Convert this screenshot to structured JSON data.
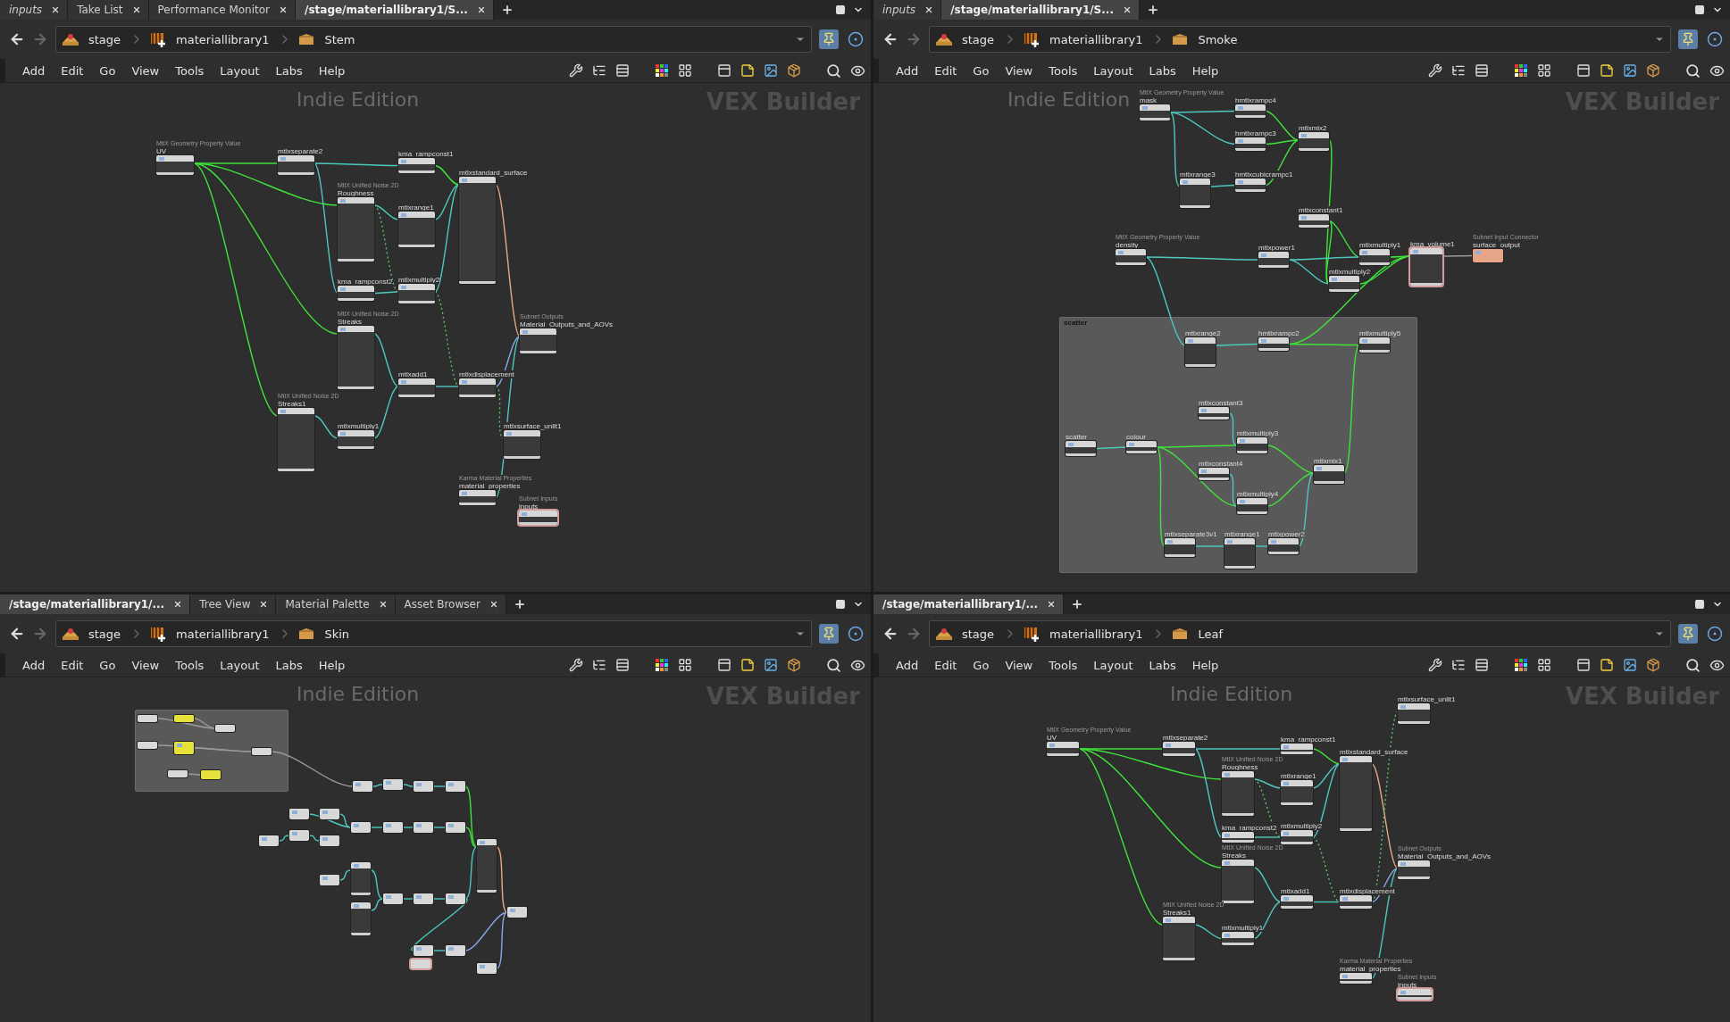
{
  "panes": [
    {
      "tabs": [
        {
          "label": "inputs",
          "selected": false,
          "italic": true
        },
        {
          "label": "Take List",
          "selected": false,
          "italic": false
        },
        {
          "label": "Performance Monitor",
          "selected": false,
          "italic": false
        },
        {
          "label": "/stage/materiallibrary1/S...",
          "selected": true,
          "italic": false
        }
      ],
      "path": [
        "stage",
        "materiallibrary1",
        "Stem"
      ],
      "menu": [
        "Add",
        "Edit",
        "Go",
        "View",
        "Tools",
        "Layout",
        "Labs",
        "Help"
      ],
      "watermarks": [
        "Indie Edition",
        "VEX Builder"
      ],
      "nodes": [
        {
          "subtitle": "MtlX Geometry Property Value",
          "name": "UV",
          "outlined": false
        },
        {
          "name": "mtlxseparate2",
          "outlined": false
        },
        {
          "name": "kma_rampconst1",
          "outlined": false
        },
        {
          "name": "mtlxstandard_surface",
          "outlined": false
        },
        {
          "subtitle": "MtlX Unified Noise 2D",
          "name": "Roughness",
          "outlined": false
        },
        {
          "name": "mtlxrange1",
          "outlined": false
        },
        {
          "name": "kma_rampconst2",
          "outlined": false
        },
        {
          "name": "mtlxmultiply2",
          "outlined": false
        },
        {
          "subtitle": "MtlX Unified Noise 2D",
          "name": "Streaks",
          "outlined": false
        },
        {
          "name": "mtlxadd1",
          "outlined": false
        },
        {
          "name": "mtlxdisplacement",
          "outlined": false
        },
        {
          "subtitle": "Subnet Outputs",
          "name": "Material_Outputs_and_AOVs",
          "outlined": false
        },
        {
          "subtitle": "MtlX Unified Noise 2D",
          "name": "Streaks1",
          "outlined": false
        },
        {
          "name": "mtlxmultiply1",
          "outlined": false
        },
        {
          "name": "mtlxsurface_unlit1",
          "outlined": false
        },
        {
          "subtitle": "Karma Material Properties",
          "name": "material_properties",
          "outlined": false
        },
        {
          "subtitle": "Subnet Inputs",
          "name": "inputs",
          "outlined": true
        }
      ]
    },
    {
      "tabs": [
        {
          "label": "inputs",
          "selected": false,
          "italic": true
        },
        {
          "label": "/stage/materiallibrary1/S...",
          "selected": true,
          "italic": false
        }
      ],
      "path": [
        "stage",
        "materiallibrary1",
        "Smoke"
      ],
      "menu": [
        "Add",
        "Edit",
        "Go",
        "View",
        "Tools",
        "Layout",
        "Labs",
        "Help"
      ],
      "watermarks": [
        "Indie Edition",
        "VEX Builder"
      ],
      "nodes": [
        {
          "subtitle": "MtlX Geometry Property Value",
          "name": "mask",
          "outlined": false
        },
        {
          "name": "hmtlxrampc4",
          "outlined": false
        },
        {
          "name": "hmtlxrampc3",
          "outlined": false
        },
        {
          "name": "mtlxmix2",
          "outlined": false
        },
        {
          "name": "mtlxrange3",
          "outlined": false
        },
        {
          "name": "hmtlxcubicrampc1",
          "outlined": false
        },
        {
          "name": "mtlxconstant1",
          "outlined": false
        },
        {
          "subtitle": "MtlX Geometry Property Value",
          "name": "density",
          "outlined": false
        },
        {
          "name": "mtlxpower1",
          "outlined": false
        },
        {
          "name": "mtlxmultiply1",
          "outlined": false
        },
        {
          "name": "mtlxmultiply2",
          "outlined": false
        },
        {
          "name": "kma_volume1",
          "outlined": true
        },
        {
          "subtitle": "Subnet Input Connector",
          "name": "surface_output",
          "outlined": false,
          "color": "#e8a688"
        }
      ],
      "network_box": {
        "title": "scatter",
        "nodes": [
          {
            "name": "mtlxrange2",
            "outlined": false
          },
          {
            "name": "hmtlxrampc2",
            "outlined": false
          },
          {
            "name": "mtlxmultiply5",
            "outlined": false
          },
          {
            "name": "mtlxconstant3",
            "outlined": false
          },
          {
            "name": "scatter",
            "outlined": false
          },
          {
            "name": "colour",
            "outlined": false
          },
          {
            "name": "mtlxmultiply3",
            "outlined": false
          },
          {
            "name": "mtlxconstant4",
            "outlined": false
          },
          {
            "name": "mtlxmix1",
            "outlined": false
          },
          {
            "name": "mtlxmultiply4",
            "outlined": false
          },
          {
            "name": "mtlxseparate3v1",
            "outlined": false
          },
          {
            "name": "mtlxrange1",
            "outlined": false
          },
          {
            "name": "mtlxpower2",
            "outlined": false
          }
        ]
      }
    },
    {
      "tabs": [
        {
          "label": "/stage/materiallibrary1/...",
          "selected": true,
          "italic": false
        },
        {
          "label": "Tree View",
          "selected": false,
          "italic": false
        },
        {
          "label": "Material Palette",
          "selected": false,
          "italic": false
        },
        {
          "label": "Asset Browser",
          "selected": false,
          "italic": false
        }
      ],
      "path": [
        "stage",
        "materiallibrary1",
        "Skin"
      ],
      "menu": [
        "Add",
        "Edit",
        "Go",
        "View",
        "Tools",
        "Layout",
        "Labs",
        "Help"
      ],
      "watermarks": [
        "Indie Edition",
        "VEX Builder"
      ],
      "nodes": [
        {
          "outlined": false,
          "color": "#d8d8d8"
        },
        {
          "outlined": false,
          "color": "#e6e23a"
        },
        {
          "outlined": false,
          "color": "#d8d8d8"
        },
        {
          "outlined": false,
          "color": "#d8d8d8"
        },
        {
          "outlined": false,
          "color": "#e6e23a"
        },
        {
          "outlined": false,
          "color": "#d8d8d8"
        },
        {
          "outlined": false,
          "color": "#d8d8d8"
        },
        {
          "outlined": false,
          "color": "#e6e23a"
        },
        {
          "outlined": false,
          "color": "#d8d8d8"
        },
        {
          "outlined": false,
          "color": "#d8d8d8"
        },
        {
          "outlined": false,
          "color": "#d8d8d8"
        },
        {
          "outlined": false,
          "color": "#d8d8d8"
        },
        {
          "outlined": false,
          "color": "#d8d8d8"
        },
        {
          "outlined": false,
          "color": "#d8d8d8"
        },
        {
          "outlined": false,
          "color": "#d8d8d8"
        },
        {
          "outlined": false,
          "color": "#d8d8d8"
        },
        {
          "outlined": false,
          "color": "#d8d8d8"
        },
        {
          "outlined": false,
          "color": "#d8d8d8"
        },
        {
          "outlined": false,
          "color": "#d8d8d8"
        },
        {
          "outlined": false,
          "color": "#d8d8d8"
        },
        {
          "outlined": false,
          "color": "#d8d8d8"
        },
        {
          "outlined": false,
          "color": "#d8d8d8"
        },
        {
          "outlined": false,
          "color": "#d8d8d8"
        },
        {
          "outlined": false,
          "color": "#d8d8d8"
        },
        {
          "outlined": false,
          "color": "#d8d8d8"
        },
        {
          "outlined": false,
          "color": "#d8d8d8"
        },
        {
          "outlined": false,
          "color": "#d8d8d8"
        },
        {
          "outlined": false,
          "color": "#d8d8d8"
        },
        {
          "outlined": false,
          "color": "#d8d8d8"
        },
        {
          "outlined": true,
          "color": "#d8d8d8"
        },
        {
          "outlined": false,
          "color": "#d8d8d8"
        },
        {
          "outlined": false,
          "color": "#d8d8d8"
        },
        {
          "outlined": false,
          "color": "#d8d8d8"
        }
      ]
    },
    {
      "tabs": [
        {
          "label": "/stage/materiallibrary1/...",
          "selected": true,
          "italic": false
        }
      ],
      "path": [
        "stage",
        "materiallibrary1",
        "Leaf"
      ],
      "menu": [
        "Add",
        "Edit",
        "Go",
        "View",
        "Tools",
        "Layout",
        "Labs",
        "Help"
      ],
      "watermarks": [
        "Indie Edition",
        "VEX Builder"
      ],
      "nodes": [
        {
          "subtitle": "MtlX Geometry Property Value",
          "name": "UV",
          "outlined": false
        },
        {
          "name": "mtlxseparate2",
          "outlined": false
        },
        {
          "name": "kma_rampconst1",
          "outlined": false
        },
        {
          "name": "mtlxstandard_surface",
          "outlined": false
        },
        {
          "subtitle": "MtlX Unified Noise 2D",
          "name": "Roughness",
          "outlined": false
        },
        {
          "name": "mtlxrange1",
          "outlined": false
        },
        {
          "name": "kma_rampconst2",
          "outlined": false
        },
        {
          "name": "mtlxmultiply2",
          "outlined": false
        },
        {
          "subtitle": "MtlX Unified Noise 2D",
          "name": "Streaks",
          "outlined": false
        },
        {
          "name": "mtlxadd1",
          "outlined": false
        },
        {
          "name": "mtlxdisplacement",
          "outlined": false
        },
        {
          "subtitle": "Subnet Outputs",
          "name": "Material_Outputs_and_AOVs",
          "outlined": false
        },
        {
          "subtitle": "MtlX Unified Noise 2D",
          "name": "Streaks1",
          "outlined": false
        },
        {
          "name": "mtlxmultiply1",
          "outlined": false
        },
        {
          "name": "mtlxsurface_unlit1",
          "outlined": false
        },
        {
          "subtitle": "Karma Material Properties",
          "name": "material_properties",
          "outlined": false
        },
        {
          "subtitle": "Subnet Inputs",
          "name": "inputs",
          "outlined": true
        }
      ]
    }
  ]
}
